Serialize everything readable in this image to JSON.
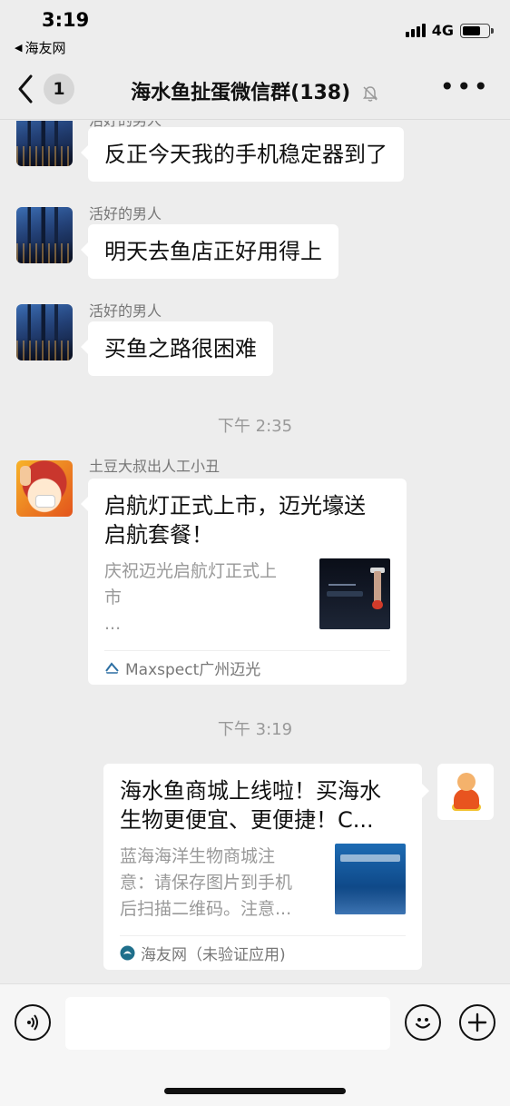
{
  "status_bar": {
    "time": "3:19",
    "back_app": "海友网",
    "network": "4G"
  },
  "nav": {
    "unread_count": "1",
    "title": "海水鱼扯蛋微信群(138)",
    "mute_icon": "bell-muted-icon",
    "more": "•••"
  },
  "messages": [
    {
      "type": "text",
      "sender": "活好的男人",
      "text": "反正今天我的手机稳定器到了",
      "avatar": "city-night-avatar"
    },
    {
      "type": "text",
      "sender": "活好的男人",
      "text": "明天去鱼店正好用得上",
      "avatar": "city-night-avatar"
    },
    {
      "type": "text",
      "sender": "活好的男人",
      "text": "买鱼之路很困难",
      "avatar": "city-night-avatar"
    },
    {
      "type": "time",
      "text": "下午 2:35"
    },
    {
      "type": "link",
      "sender": "土豆大叔出人工小丑",
      "avatar": "clown-avatar",
      "title": "启航灯正式上市，迈光壕送启航套餐！",
      "title_line1": "启航灯正式上市，迈光壕送",
      "title_line2": "启航套餐！",
      "desc_line1": "庆祝迈光启航灯正式上",
      "desc_line2": "市",
      "desc_line3": "...",
      "source": "Maxspect广州迈光"
    },
    {
      "type": "time",
      "text": "下午 3:19"
    },
    {
      "type": "link",
      "sender": "",
      "self": true,
      "avatar": "scooter-avatar",
      "title_line1": "海水鱼商城上线啦！买海水",
      "title_line2": "生物更便宜、更便捷！C...",
      "desc_line1": "蓝海海洋生物商城注",
      "desc_line2": "意：请保存图片到手机",
      "desc_line3": "后扫描二维码。注意...",
      "source": "海友网（未验证应用)"
    }
  ],
  "input_bar": {
    "voice_icon": "voice-icon",
    "emoji_icon": "emoji-icon",
    "plus_icon": "plus-icon",
    "input_value": ""
  },
  "colors": {
    "background": "#ededed",
    "bubble": "#ffffff",
    "muted_text": "#999999"
  }
}
